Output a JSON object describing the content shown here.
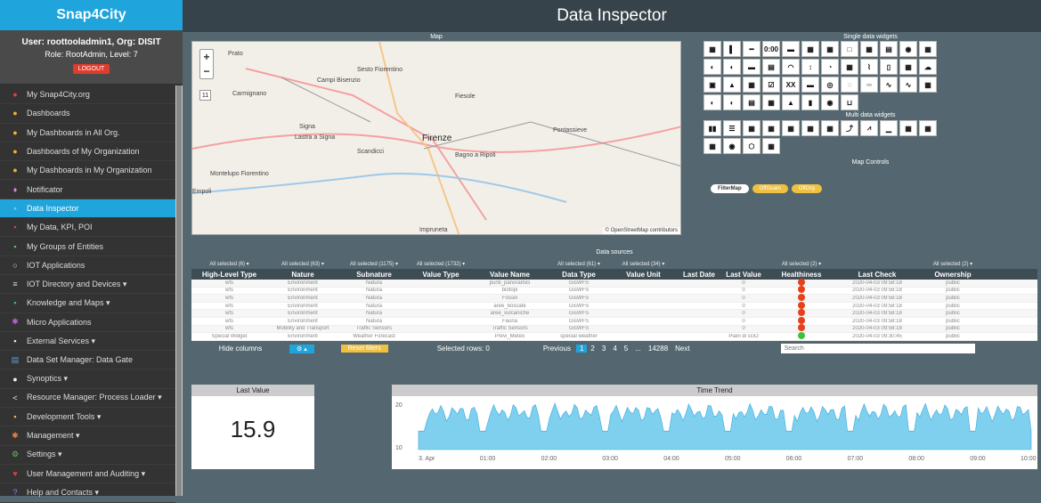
{
  "brand": "Snap4City",
  "user": {
    "line1": "User: roottooladmin1, Org: DISIT",
    "line2": "Role: RootAdmin, Level: 7",
    "logout": "LOGOUT"
  },
  "menu": [
    {
      "label": "My Snap4City.org",
      "icon": "●",
      "color": "#e04040"
    },
    {
      "label": "Dashboards",
      "icon": "●",
      "color": "#f0b030"
    },
    {
      "label": "My Dashboards in All Org.",
      "icon": "●",
      "color": "#f0b030"
    },
    {
      "label": "Dashboards of My Organization",
      "icon": "●",
      "color": "#f0b030"
    },
    {
      "label": "My Dashboards in My Organization",
      "icon": "●",
      "color": "#f0b030"
    },
    {
      "label": "Notificator",
      "icon": "♦",
      "color": "#e080e0"
    },
    {
      "label": "Data Inspector",
      "icon": "◦",
      "color": "#fff"
    },
    {
      "label": "My Data, KPI, POI",
      "icon": "▪",
      "color": "#e04040"
    },
    {
      "label": "My Groups of Entities",
      "icon": "▪",
      "color": "#60c060"
    },
    {
      "label": "IOT Applications",
      "icon": "○",
      "color": "#ddd"
    },
    {
      "label": "IOT Directory and Devices ▾",
      "icon": "≡",
      "color": "#ddd"
    },
    {
      "label": "Knowledge and Maps ▾",
      "icon": "▪",
      "color": "#40c060"
    },
    {
      "label": "Micro Applications",
      "icon": "✱",
      "color": "#c060e0"
    },
    {
      "label": "External Services ▾",
      "icon": "▪",
      "color": "#eee"
    },
    {
      "label": "Data Set Manager: Data Gate",
      "icon": "▤",
      "color": "#60a0e0"
    },
    {
      "label": "Synoptics ▾",
      "icon": "●",
      "color": "#eee"
    },
    {
      "label": "Resource Manager: Process Loader ▾",
      "icon": "<",
      "color": "#eee"
    },
    {
      "label": "Development Tools ▾",
      "icon": "▪",
      "color": "#f0c040"
    },
    {
      "label": "Management ▾",
      "icon": "✱",
      "color": "#f08040"
    },
    {
      "label": "Settings ▾",
      "icon": "⚙",
      "color": "#60c060"
    },
    {
      "label": "User Management and Auditing ▾",
      "icon": "♥",
      "color": "#e04040"
    },
    {
      "label": "Help and Contacts ▾",
      "icon": "?",
      "color": "#a080e0"
    }
  ],
  "page_title": "Data Inspector",
  "map_title": "Map",
  "map_attribution": "© OpenStreetMap contributors",
  "map_level": "11",
  "map_labels": [
    "Prato",
    "Sesto Fiorentino",
    "Campi Bisenzio",
    "Carmignano",
    "Fiesole",
    "Signa",
    "Lastra a Signa",
    "Scandicci",
    "Firenze",
    "Pontassieve",
    "Bagno a Ripoli",
    "Montelupo Fiorentino",
    "Impruneta",
    "Empoli"
  ],
  "single_title": "Single data widgets",
  "multi_title": "Multi data widgets",
  "map_controls_title": "Map Controls",
  "map_controls": [
    "FilterMap",
    "OffGuam",
    "OffOrg"
  ],
  "ds_title": "Data sources",
  "filters": [
    "All selected (6) ▾",
    "All selected (63) ▾",
    "All selected (1175) ▾",
    "All selected (1732) ▾",
    "",
    "All selected (61) ▾",
    "All selected (34) ▾",
    "",
    "",
    "All selected (2) ▾",
    "",
    "All selected (2) ▾"
  ],
  "columns": [
    "High-Level Type",
    "Nature",
    "Subnature",
    "Value Type",
    "Value Name",
    "Data Type",
    "Value Unit",
    "Last Date",
    "Last Value",
    "Healthiness",
    "Last Check",
    "Ownership"
  ],
  "rows": [
    [
      "wfs",
      "Environment",
      "Natura",
      "",
      "punti_panoramici",
      "GisWFS",
      "",
      "",
      "0",
      "red",
      "2020-04-03 09:58:18",
      "public"
    ],
    [
      "wfs",
      "Environment",
      "Natura",
      "",
      "biotopi",
      "GisWFS",
      "",
      "",
      "0",
      "red",
      "2020-04-03 09:58:18",
      "public"
    ],
    [
      "wfs",
      "Environment",
      "Natura",
      "",
      "Fossili",
      "GisWFS",
      "",
      "",
      "0",
      "red",
      "2020-04-03 09:58:18",
      "public"
    ],
    [
      "wfs",
      "Environment",
      "Natura",
      "",
      "aree_boscate",
      "GisWFS",
      "",
      "",
      "0",
      "red",
      "2020-04-03 09:58:18",
      "public"
    ],
    [
      "wfs",
      "Environment",
      "Natura",
      "",
      "aree_vulcaniche",
      "GisWFS",
      "",
      "",
      "0",
      "red",
      "2020-04-03 09:58:18",
      "public"
    ],
    [
      "wfs",
      "Environment",
      "Natura",
      "",
      "Fauna",
      "GisWFS",
      "",
      "",
      "0",
      "red",
      "2020-04-03 09:58:18",
      "public"
    ],
    [
      "wfs",
      "Mobility and Transport",
      "Traffic Sensors",
      "",
      "Traffic Sensors",
      "GisWFS",
      "",
      "",
      "0",
      "red",
      "2020-04-03 09:58:18",
      "public"
    ],
    [
      "Special Widget",
      "Environment",
      "Weather Forecast",
      "",
      "Previ_Meteo",
      "special weather",
      "",
      "",
      "Piani di sciÒ",
      "green",
      "2020-04-03 09:30:45",
      "public"
    ]
  ],
  "footer": {
    "hide_columns": "Hide columns",
    "col_btn": "⚙ ▴",
    "reset": "Reset filters",
    "selected": "Selected rows: 0",
    "previous": "Previous",
    "pages": [
      "1",
      "2",
      "3",
      "4",
      "5",
      "...",
      "14288"
    ],
    "next": "Next",
    "search_placeholder": "Search"
  },
  "last_value": {
    "title": "Last Value",
    "value": "15.9"
  },
  "time_trend": {
    "title": "Time Trend",
    "y_ticks": [
      "20",
      "10"
    ],
    "x_ticks": [
      "3. Apr",
      "01:00",
      "02:00",
      "03:00",
      "04:00",
      "05:00",
      "06:00",
      "07:00",
      "08:00",
      "09:00",
      "10:00"
    ],
    "color": "#7fd0ef"
  }
}
